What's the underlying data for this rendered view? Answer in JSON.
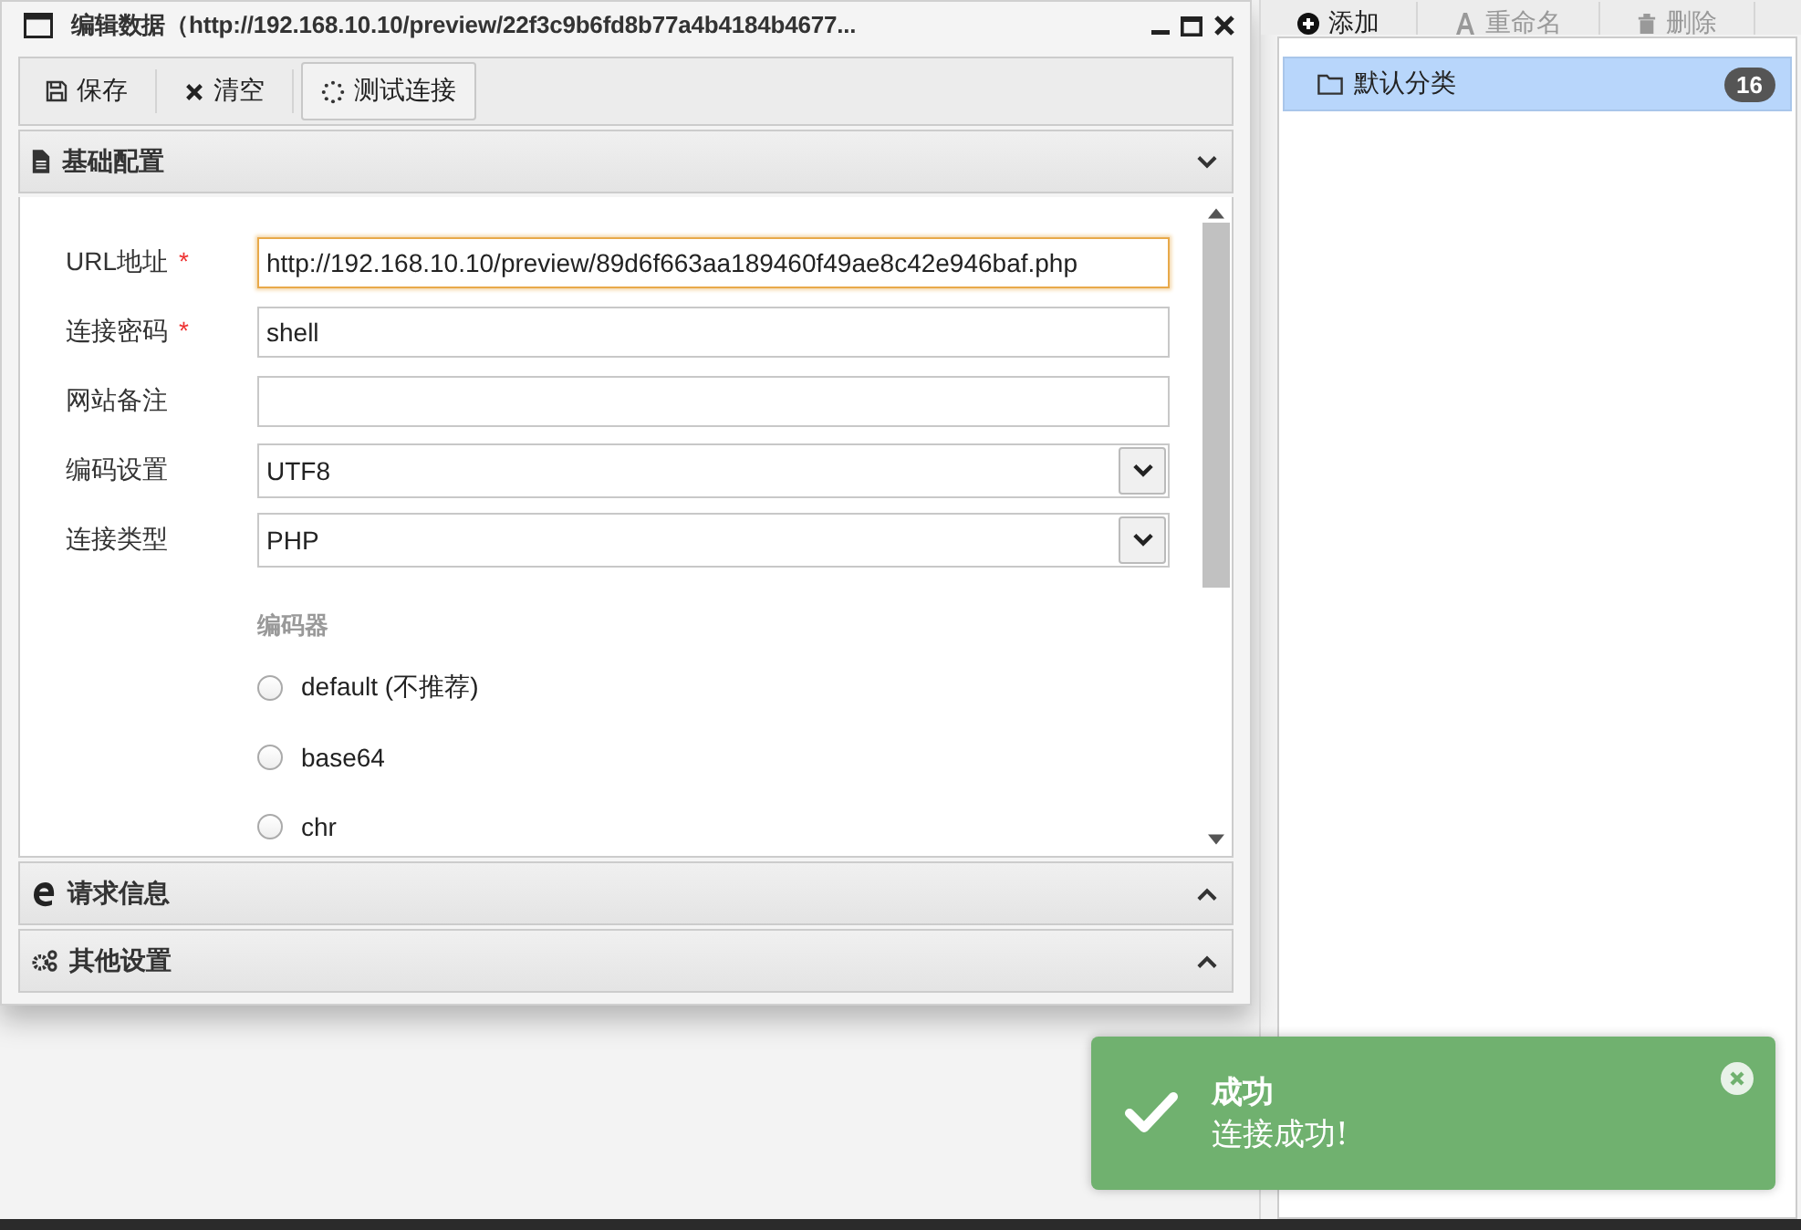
{
  "window": {
    "title": "编辑数据（http://192.168.10.10/preview/22f3c9b6fd8b77a4b4184b4677..."
  },
  "toolbar": [
    {
      "label": "保存",
      "kind": "save",
      "hovered": false
    },
    {
      "label": "清空",
      "kind": "clear",
      "hovered": false
    },
    {
      "label": "测试连接",
      "kind": "test",
      "hovered": true
    }
  ],
  "sections": [
    {
      "title": "基础配置",
      "kind": "doc",
      "expanded": true
    },
    {
      "title": "请求信息",
      "kind": "edge",
      "expanded": false
    },
    {
      "title": "其他设置",
      "kind": "gears",
      "expanded": false
    }
  ],
  "fields": [
    {
      "label": "URL地址",
      "required_mark": "*",
      "kind": "text",
      "value": "http://192.168.10.10/preview/89d6f663aa189460f49ae8c42e946baf.php",
      "focused": true
    },
    {
      "label": "连接密码",
      "required_mark": "*",
      "kind": "text",
      "value": "shell",
      "focused": false
    },
    {
      "label": "网站备注",
      "kind": "text",
      "focused": false
    },
    {
      "label": "编码设置",
      "kind": "select",
      "value": "UTF8"
    },
    {
      "label": "连接类型",
      "kind": "select",
      "value": "PHP"
    }
  ],
  "encoder": {
    "label": "编码器",
    "options": [
      {
        "label": "default (不推荐)",
        "selected": false
      },
      {
        "label": "base64",
        "selected": false
      },
      {
        "label": "chr",
        "selected": false
      }
    ]
  },
  "side_toolbar": [
    {
      "label": "添加",
      "kind": "add",
      "disabled": false
    },
    {
      "label": "重命名",
      "kind": "rename",
      "disabled": true
    },
    {
      "label": "删除",
      "kind": "delete",
      "disabled": true
    }
  ],
  "categories": [
    {
      "label": "默认分类",
      "count": "16",
      "selected": true
    }
  ],
  "toast": {
    "title": "成功",
    "message": "连接成功!"
  }
}
